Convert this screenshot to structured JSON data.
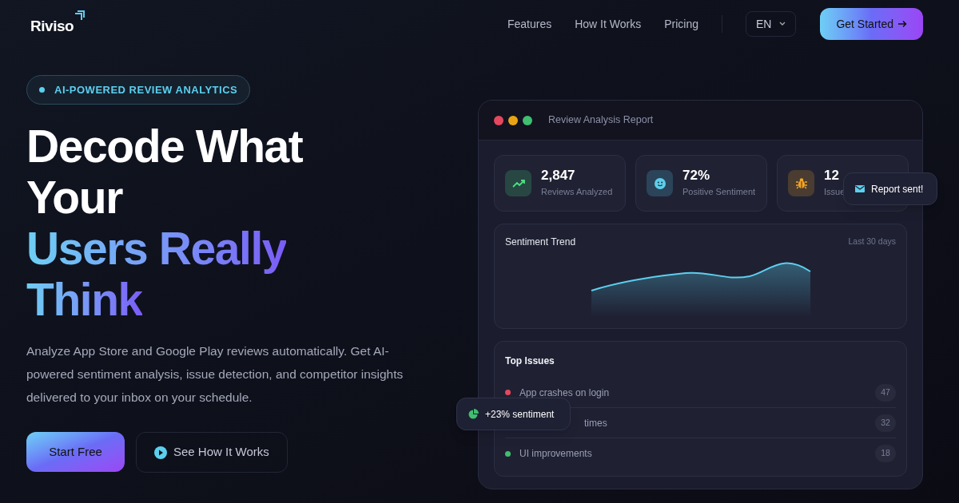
{
  "nav": {
    "brand": "Riviso",
    "links": [
      {
        "label": "Features"
      },
      {
        "label": "How It Works"
      },
      {
        "label": "Pricing"
      }
    ],
    "language": "EN",
    "cta": "Get Started"
  },
  "hero": {
    "badge": "AI-POWERED REVIEW ANALYTICS",
    "headline": [
      {
        "text": "Decode What",
        "kind": "plain"
      },
      {
        "text": "Your",
        "kind": "plain"
      },
      {
        "text": "Users Really",
        "kind": "gradient"
      },
      {
        "text": "Think",
        "kind": "gradient"
      }
    ],
    "description": "Analyze App Store and Google Play reviews automatically. Get AI-powered sentiment analysis, issue detection, and competitor insights delivered to your inbox on your schedule.",
    "buttons": [
      {
        "label": "Start Free",
        "kind": "primary"
      },
      {
        "label": "See How It Works",
        "kind": "secondary"
      }
    ]
  },
  "report": {
    "title": "Review Analysis Report",
    "stats": [
      {
        "value": "2,847",
        "label": "Reviews Analyzed",
        "kind": "trend",
        "color": "#4ade80"
      },
      {
        "value": "72%",
        "label": "Positive Sentiment",
        "kind": "smile",
        "color": "#5ccfee"
      },
      {
        "value": "12",
        "label": "Issue",
        "kind": "bug",
        "color": "#f5a524"
      }
    ],
    "trend": {
      "title": "Sentiment Trend",
      "range": "Last 30 days"
    },
    "issues_title": "Top Issues",
    "issues": [
      {
        "label": "App crashes on login",
        "count": "47",
        "color": "#e5485d"
      },
      {
        "label": "times",
        "count": "32"
      },
      {
        "label": "UI improvements",
        "count": "18",
        "color": "#3fbf6f"
      }
    ]
  },
  "toasts": [
    {
      "text": "Report sent!",
      "kind": "mail"
    },
    {
      "text": "+23% sentiment",
      "kind": "pie"
    }
  ]
}
